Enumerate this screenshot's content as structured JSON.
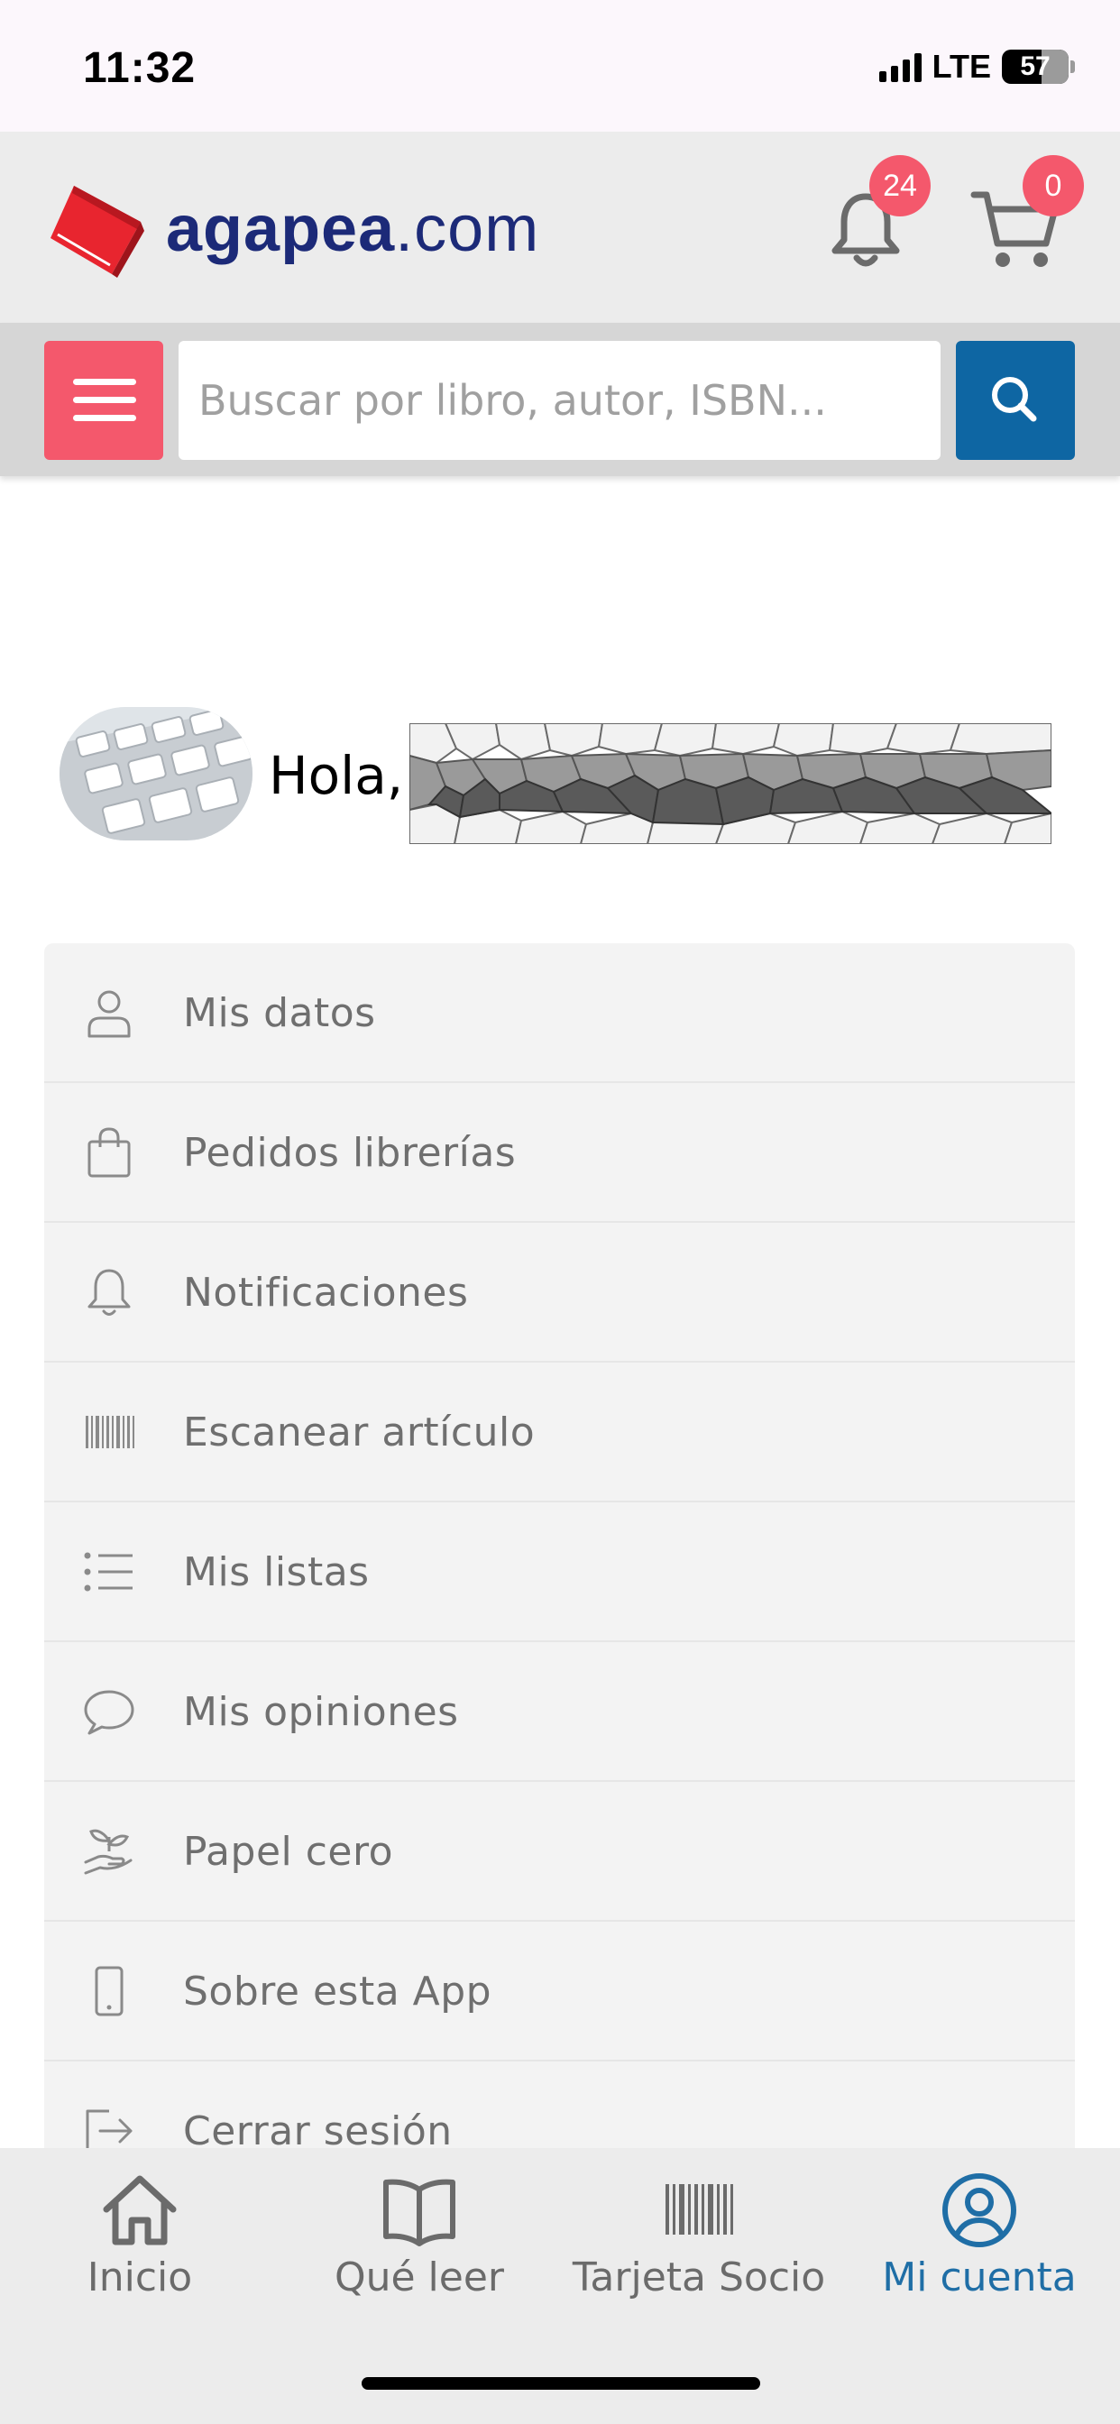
{
  "status_bar": {
    "time": "11:32",
    "network": "LTE",
    "battery": "57"
  },
  "header": {
    "logo_name": "agapea",
    "logo_suffix": ".com",
    "notifications_count": "24",
    "cart_count": "0",
    "icons": [
      "book-logo-icon",
      "bell-icon",
      "cart-icon"
    ]
  },
  "search": {
    "placeholder": "Buscar por libro, autor, ISBN...",
    "value": ""
  },
  "greeting": {
    "hello": "Hola,"
  },
  "menu": {
    "items": [
      {
        "label": "Mis datos",
        "icon": "user-icon"
      },
      {
        "label": "Pedidos librerías",
        "icon": "bag-icon"
      },
      {
        "label": "Notificaciones",
        "icon": "bell-icon"
      },
      {
        "label": "Escanear artículo",
        "icon": "barcode-icon"
      },
      {
        "label": "Mis listas",
        "icon": "list-icon"
      },
      {
        "label": "Mis opiniones",
        "icon": "speech-bubble-icon"
      },
      {
        "label": "Papel cero",
        "icon": "plant-hand-icon"
      },
      {
        "label": "Sobre esta App",
        "icon": "phone-icon"
      },
      {
        "label": "Cerrar sesión",
        "icon": "logout-icon"
      }
    ]
  },
  "tabbar": {
    "tabs": [
      {
        "label": "Inicio",
        "icon": "home-icon"
      },
      {
        "label": "Qué leer",
        "icon": "open-book-icon"
      },
      {
        "label": "Tarjeta Socio",
        "icon": "barcode-icon"
      },
      {
        "label": "Mi cuenta",
        "icon": "user-circle-icon",
        "active": true
      }
    ]
  },
  "colors": {
    "brand_red": "#e8252f",
    "brand_navy": "#1c2a78",
    "badge": "#f4586c",
    "search_button": "#0e66a3",
    "active_tab": "#1f6ea6",
    "menu_text": "#6f6f6f"
  }
}
